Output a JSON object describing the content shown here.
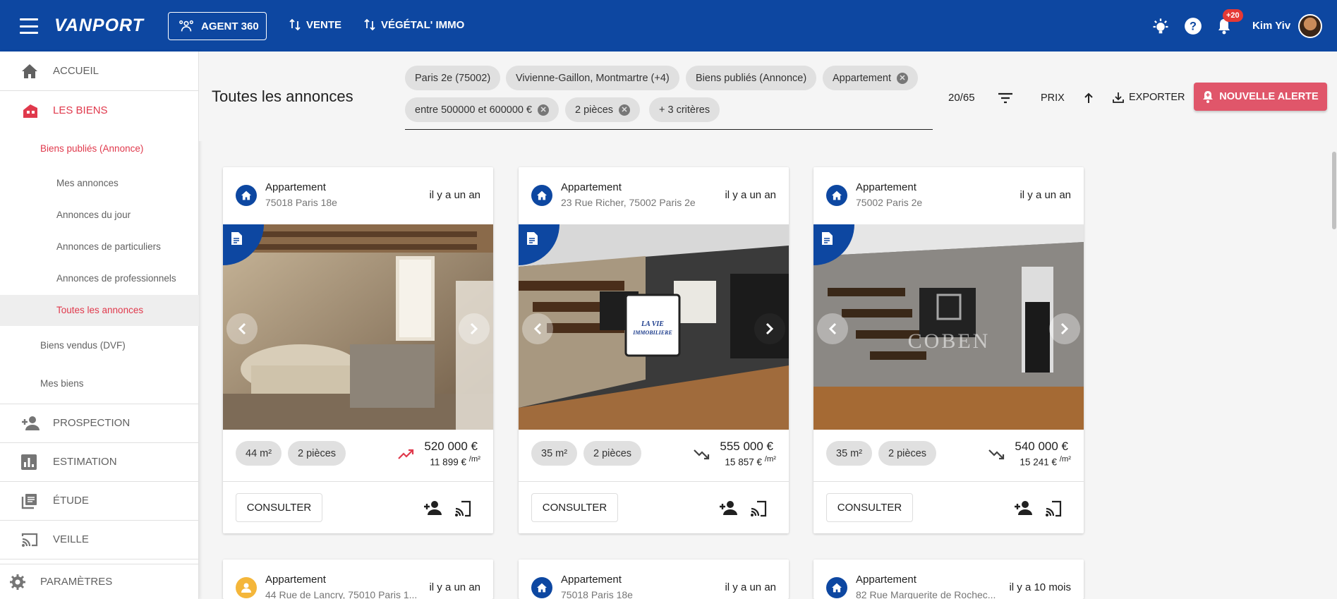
{
  "topbar": {
    "logo": "VANPORT",
    "agent_button": "AGENT 360",
    "nav": [
      "VENTE",
      "VÉGÉTAL' IMMO"
    ],
    "notifications_badge": "+20",
    "user_name": "Kim Yiv"
  },
  "sidebar": {
    "items": [
      {
        "label": "ACCUEIL",
        "icon": "home-icon"
      },
      {
        "label": "LES BIENS",
        "icon": "buildings-icon"
      },
      {
        "label": "PROSPECTION",
        "icon": "person-add-icon"
      },
      {
        "label": "ESTIMATION",
        "icon": "bar-chart-icon"
      },
      {
        "label": "ÉTUDE",
        "icon": "library-icon"
      },
      {
        "label": "VEILLE",
        "icon": "cast-icon"
      },
      {
        "label": "PARAMÈTRES",
        "icon": "gear-icon"
      }
    ],
    "biens_sub": {
      "published": "Biens publiés (Annonce)",
      "children": [
        "Mes annonces",
        "Annonces du jour",
        "Annonces de particuliers",
        "Annonces de professionnels",
        "Toutes les annonces"
      ],
      "sold": "Biens vendus (DVF)",
      "mine": "Mes biens"
    }
  },
  "header": {
    "title": "Toutes les annonces",
    "chips": [
      "Paris 2e (75002)",
      "Vivienne-Gaillon, Montmartre (+4)",
      "Biens publiés (Annonce)",
      "Appartement",
      "entre 500000 et 600000 €",
      "2 pièces",
      "+ 3 critères"
    ],
    "count": "20/65",
    "sort_label": "PRIX",
    "export_label": "EXPORTER",
    "alert_label": "NOUVELLE ALERTE"
  },
  "colors": {
    "primary": "#0d47a1",
    "accent": "#e0394c",
    "alert_button": "#e0566a"
  },
  "cards": [
    {
      "type": "Appartement",
      "address": "75018 Paris 18e",
      "date": "il y a un an",
      "surface": "44 m²",
      "rooms": "2 pièces",
      "price": "520 000 €",
      "price_m2": "11 899 €",
      "price_m2_unit": "/m²",
      "trend": "up",
      "consult": "CONSULTER"
    },
    {
      "type": "Appartement",
      "address": "23 Rue Richer, 75002 Paris 2e",
      "date": "il y a un an",
      "surface": "35 m²",
      "rooms": "2 pièces",
      "price": "555 000 €",
      "price_m2": "15 857 €",
      "price_m2_unit": "/m²",
      "trend": "down",
      "consult": "CONSULTER"
    },
    {
      "type": "Appartement",
      "address": "75002 Paris 2e",
      "date": "il y a un an",
      "surface": "35 m²",
      "rooms": "2 pièces",
      "price": "540 000 €",
      "price_m2": "15 241 €",
      "price_m2_unit": "/m²",
      "trend": "down",
      "consult": "CONSULTER"
    }
  ],
  "cards_row2": [
    {
      "type": "Appartement",
      "address": "44 Rue de Lancry, 75010 Paris 1...",
      "date": "il y a un an"
    },
    {
      "type": "Appartement",
      "address": "75018 Paris 18e",
      "date": "il y a un an"
    },
    {
      "type": "Appartement",
      "address": "82 Rue Marguerite de Rochec...",
      "date": "il y a 10 mois"
    }
  ]
}
